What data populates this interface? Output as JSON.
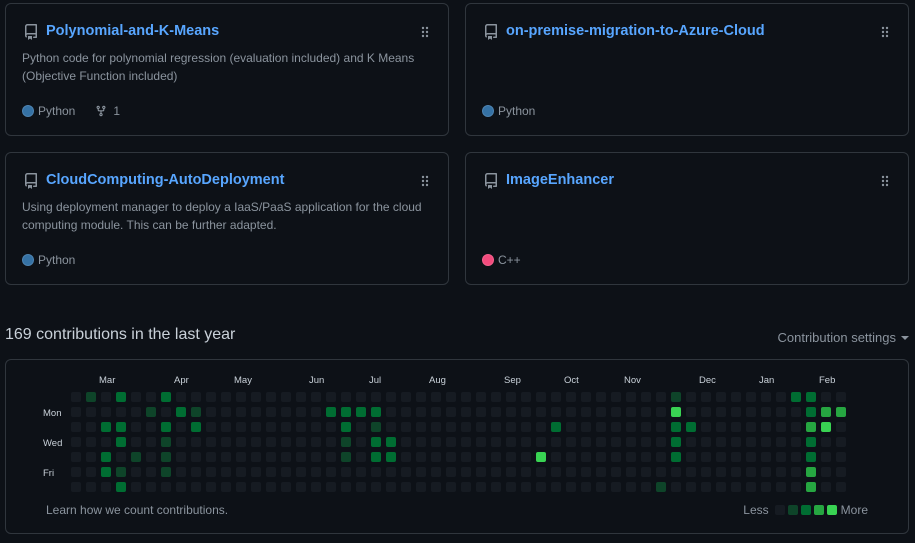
{
  "repos": [
    {
      "name": "Polynomial-and-K-Means",
      "description": "Python code for polynomial regression (evaluation included) and K Means (Objective Function included)",
      "language": "Python",
      "language_color": "#3572A5",
      "forks": "1"
    },
    {
      "name": "on-premise-migration-to-Azure-Cloud",
      "description": "",
      "language": "Python",
      "language_color": "#3572A5",
      "forks": null
    },
    {
      "name": "CloudComputing-AutoDeployment",
      "description": "Using deployment manager to deploy a IaaS/PaaS application for the cloud computing module. This can be further adapted.",
      "language": "Python",
      "language_color": "#3572A5",
      "forks": null
    },
    {
      "name": "ImageEnhancer",
      "description": "",
      "language": "C++",
      "language_color": "#f34b7d",
      "forks": null
    }
  ],
  "contributions": {
    "title": "169 contributions in the last year",
    "settings_label": "Contribution settings",
    "months": [
      {
        "label": "Mar",
        "week": 1
      },
      {
        "label": "Apr",
        "week": 6
      },
      {
        "label": "May",
        "week": 10
      },
      {
        "label": "Jun",
        "week": 15
      },
      {
        "label": "Jul",
        "week": 19
      },
      {
        "label": "Aug",
        "week": 23
      },
      {
        "label": "Sep",
        "week": 28
      },
      {
        "label": "Oct",
        "week": 32
      },
      {
        "label": "Nov",
        "week": 36
      },
      {
        "label": "Dec",
        "week": 41
      },
      {
        "label": "Jan",
        "week": 45
      },
      {
        "label": "Feb",
        "week": 49
      }
    ],
    "day_labels": [
      "",
      "Mon",
      "",
      "Wed",
      "",
      "Fri",
      ""
    ],
    "level_colors": [
      "#161b22",
      "#0e4429",
      "#006d32",
      "#26a641",
      "#39d353"
    ],
    "levels_by_week": [
      "0000000",
      "1000000",
      "0020220",
      "2022012",
      "0000100",
      "0100000",
      "2021110",
      "0200000",
      "0120000",
      "0000000",
      "0000000",
      "0000000",
      "0000000",
      "0000000",
      "0000000",
      "0000000",
      "0000000",
      "0200000",
      "0221100",
      "0200000",
      "0212200",
      "0002200",
      "0000000",
      "0000000",
      "0000000",
      "0000000",
      "0000000",
      "0000000",
      "0000000",
      "0000000",
      "0000000",
      "0000400",
      "0020000",
      "0000000",
      "0000000",
      "0000000",
      "0000000",
      "0000000",
      "0000000",
      "0000001",
      "1422200",
      "0020000",
      "0000000",
      "0000000",
      "0000000",
      "0000000",
      "0000000",
      "0000000",
      "2000000",
      "2232233",
      "0340000",
      "0300000"
    ],
    "learn_label": "Learn how we count contributions.",
    "legend_less": "Less",
    "legend_more": "More"
  }
}
